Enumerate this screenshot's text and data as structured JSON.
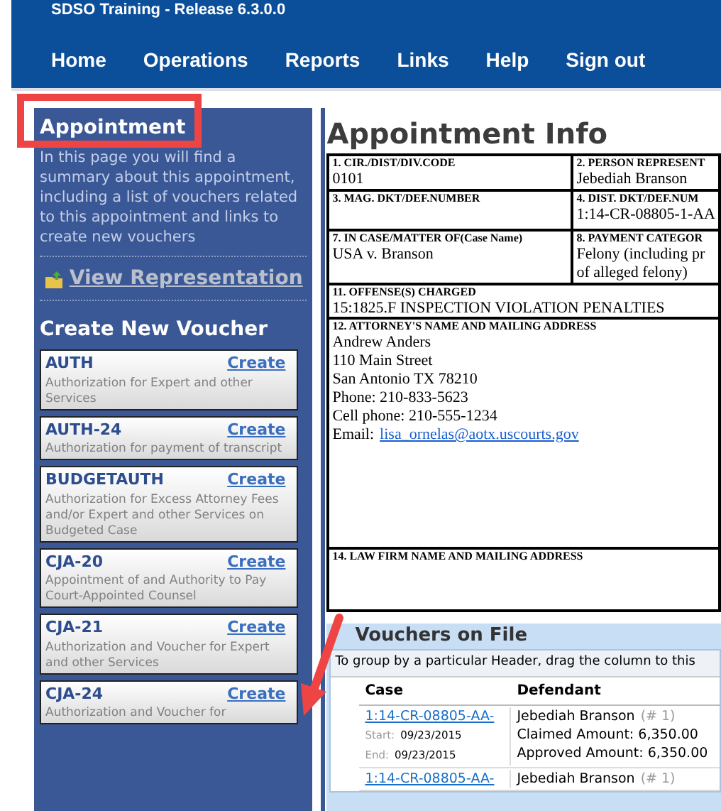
{
  "header": {
    "title": "SDSO Training - Release 6.3.0.0",
    "nav": [
      "Home",
      "Operations",
      "Reports",
      "Links",
      "Help",
      "Sign out"
    ]
  },
  "sidebar": {
    "heading": "Appointment",
    "description": "In this page you will find a summary about this appointment, including a list of vouchers related to this appointment and links to create new vouchers",
    "view_link": "View Representation",
    "voucher_heading": "Create New Voucher",
    "vouchers": [
      {
        "code": "AUTH",
        "action": "Create",
        "description": "Authorization for Expert and other Services"
      },
      {
        "code": "AUTH-24",
        "action": "Create",
        "description": "Authorization for payment of transcript"
      },
      {
        "code": "BUDGETAUTH",
        "action": "Create",
        "description": "Authorization for Excess Attorney Fees and/or Expert and other Services on Budgeted Case"
      },
      {
        "code": "CJA-20",
        "action": "Create",
        "description": "Appointment of and Authority to Pay Court-Appointed Counsel"
      },
      {
        "code": "CJA-21",
        "action": "Create",
        "description": "Authorization and Voucher for Expert and other Services"
      },
      {
        "code": "CJA-24",
        "action": "Create",
        "description": "Authorization and Voucher for"
      }
    ]
  },
  "main": {
    "title": "Appointment Info",
    "form_rows": [
      {
        "cells": [
          {
            "label": "1. CIR./DIST/DIV.CODE",
            "lines": [
              "0101"
            ]
          },
          {
            "label": "2. PERSON REPRESENT",
            "lines": [
              "Jebediah Branson"
            ]
          }
        ]
      },
      {
        "cells": [
          {
            "label": "3. MAG. DKT/DEF.NUMBER"
          },
          {
            "label": "4. DIST. DKT/DEF.NUM",
            "lines": [
              "1:14-CR-08805-1-AA"
            ]
          }
        ]
      },
      {
        "cells": [
          {
            "label": "7. IN CASE/MATTER OF(Case Name)",
            "lines": [
              "USA v. Branson"
            ]
          },
          {
            "label": "8. PAYMENT CATEGOR",
            "lines": [
              "Felony (including pr",
              "of alleged felony)"
            ]
          }
        ]
      },
      {
        "cells": [
          {
            "label": "11. OFFENSE(S) CHARGED",
            "lines": [
              "15:1825.F INSPECTION VIOLATION PENALTIES"
            ]
          }
        ]
      },
      {
        "cells": [
          {
            "label": "12. ATTORNEY'S NAME AND MAILING ADDRESS",
            "lines": [
              "Andrew Anders",
              "110 Main Street",
              "San Antonio TX 78210",
              "Phone: 210-833-5623",
              "Cell phone: 210-555-1234"
            ],
            "email_label": "Email:",
            "email": "lisa_ornelas@aotx.uscourts.gov"
          }
        ]
      },
      {
        "cells": [
          {
            "label": "14. LAW FIRM NAME AND MAILING ADDRESS"
          }
        ]
      }
    ]
  },
  "vouchers_panel": {
    "title": "Vouchers on File",
    "hint": "To group by a particular Header, drag the column to this",
    "columns": [
      "Case",
      "Defendant"
    ],
    "rows": [
      {
        "case": "1:14-CR-08805-AA-",
        "start_label": "Start:",
        "start": "09/23/2015",
        "end_label": "End:",
        "end": "09/23/2015",
        "defendant": "Jebediah Branson",
        "number": "(# 1)",
        "claimed": "Claimed Amount: 6,350.00",
        "approved": "Approved Amount: 6,350.00"
      },
      {
        "case": "1:14-CR-08805-AA-",
        "defendant": "Jebediah Branson",
        "number": "(# 1)"
      }
    ]
  }
}
